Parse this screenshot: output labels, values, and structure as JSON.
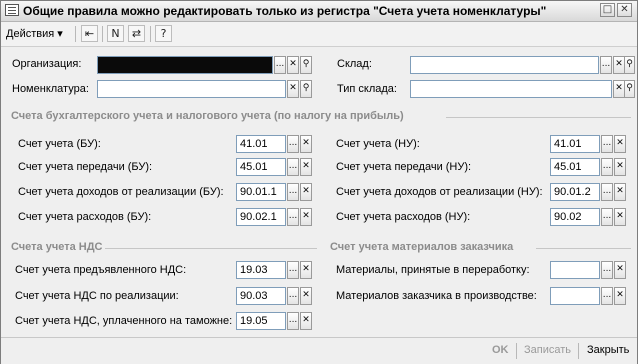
{
  "window": {
    "title": "Общие правила можно редактировать только из регистра \"Счета учета номенклатуры\""
  },
  "toolbar": {
    "actions_label": "Действия",
    "icons": [
      "back-arrow-icon",
      "formula-icon",
      "refresh-icon",
      "help-icon"
    ],
    "help_label": "?"
  },
  "header": {
    "organization_label": "Организация:",
    "organization_value": "",
    "nomenclature_label": "Номенклатура:",
    "nomenclature_value": "",
    "warehouse_label": "Склад:",
    "warehouse_value": "",
    "warehouse_type_label": "Тип склада:",
    "warehouse_type_value": ""
  },
  "accounts": {
    "title": "Счета бухгалтерского учета и налогового учета (по налогу на прибыль)",
    "left": [
      {
        "label": "Счет учета (БУ):",
        "value": "41.01"
      },
      {
        "label": "Счет учета передачи (БУ):",
        "value": "45.01"
      },
      {
        "label": "Счет учета доходов от реализации (БУ):",
        "value": "90.01.1"
      },
      {
        "label": "Счет учета расходов (БУ):",
        "value": "90.02.1"
      }
    ],
    "right": [
      {
        "label": "Счет учета (НУ):",
        "value": "41.01"
      },
      {
        "label": "Счет учета передачи (НУ):",
        "value": "45.01"
      },
      {
        "label": "Счет учета доходов от реализации (НУ):",
        "value": "90.01.2"
      },
      {
        "label": "Счет учета расходов (НУ):",
        "value": "90.02"
      }
    ]
  },
  "vat": {
    "title": "Счета учета НДС",
    "rows": [
      {
        "label": "Счет учета предъявленного НДС:",
        "value": "19.03"
      },
      {
        "label": "Счет учета НДС по реализации:",
        "value": "90.03"
      },
      {
        "label": "Счет учета НДС, уплаченного на таможне:",
        "value": "19.05"
      }
    ]
  },
  "customer_materials": {
    "title": "Счет учета материалов заказчика",
    "rows": [
      {
        "label": "Материалы, принятые в переработку:",
        "value": ""
      },
      {
        "label": "Материалов заказчика в производстве:",
        "value": ""
      }
    ]
  },
  "footer": {
    "ok_label": "OK",
    "save_label": "Записать",
    "close_label": "Закрыть"
  },
  "glyphs": {
    "select": "...",
    "clear": "✕",
    "open": "⚲",
    "win_max": "□",
    "win_close": "✕",
    "dropdown": "▾"
  }
}
